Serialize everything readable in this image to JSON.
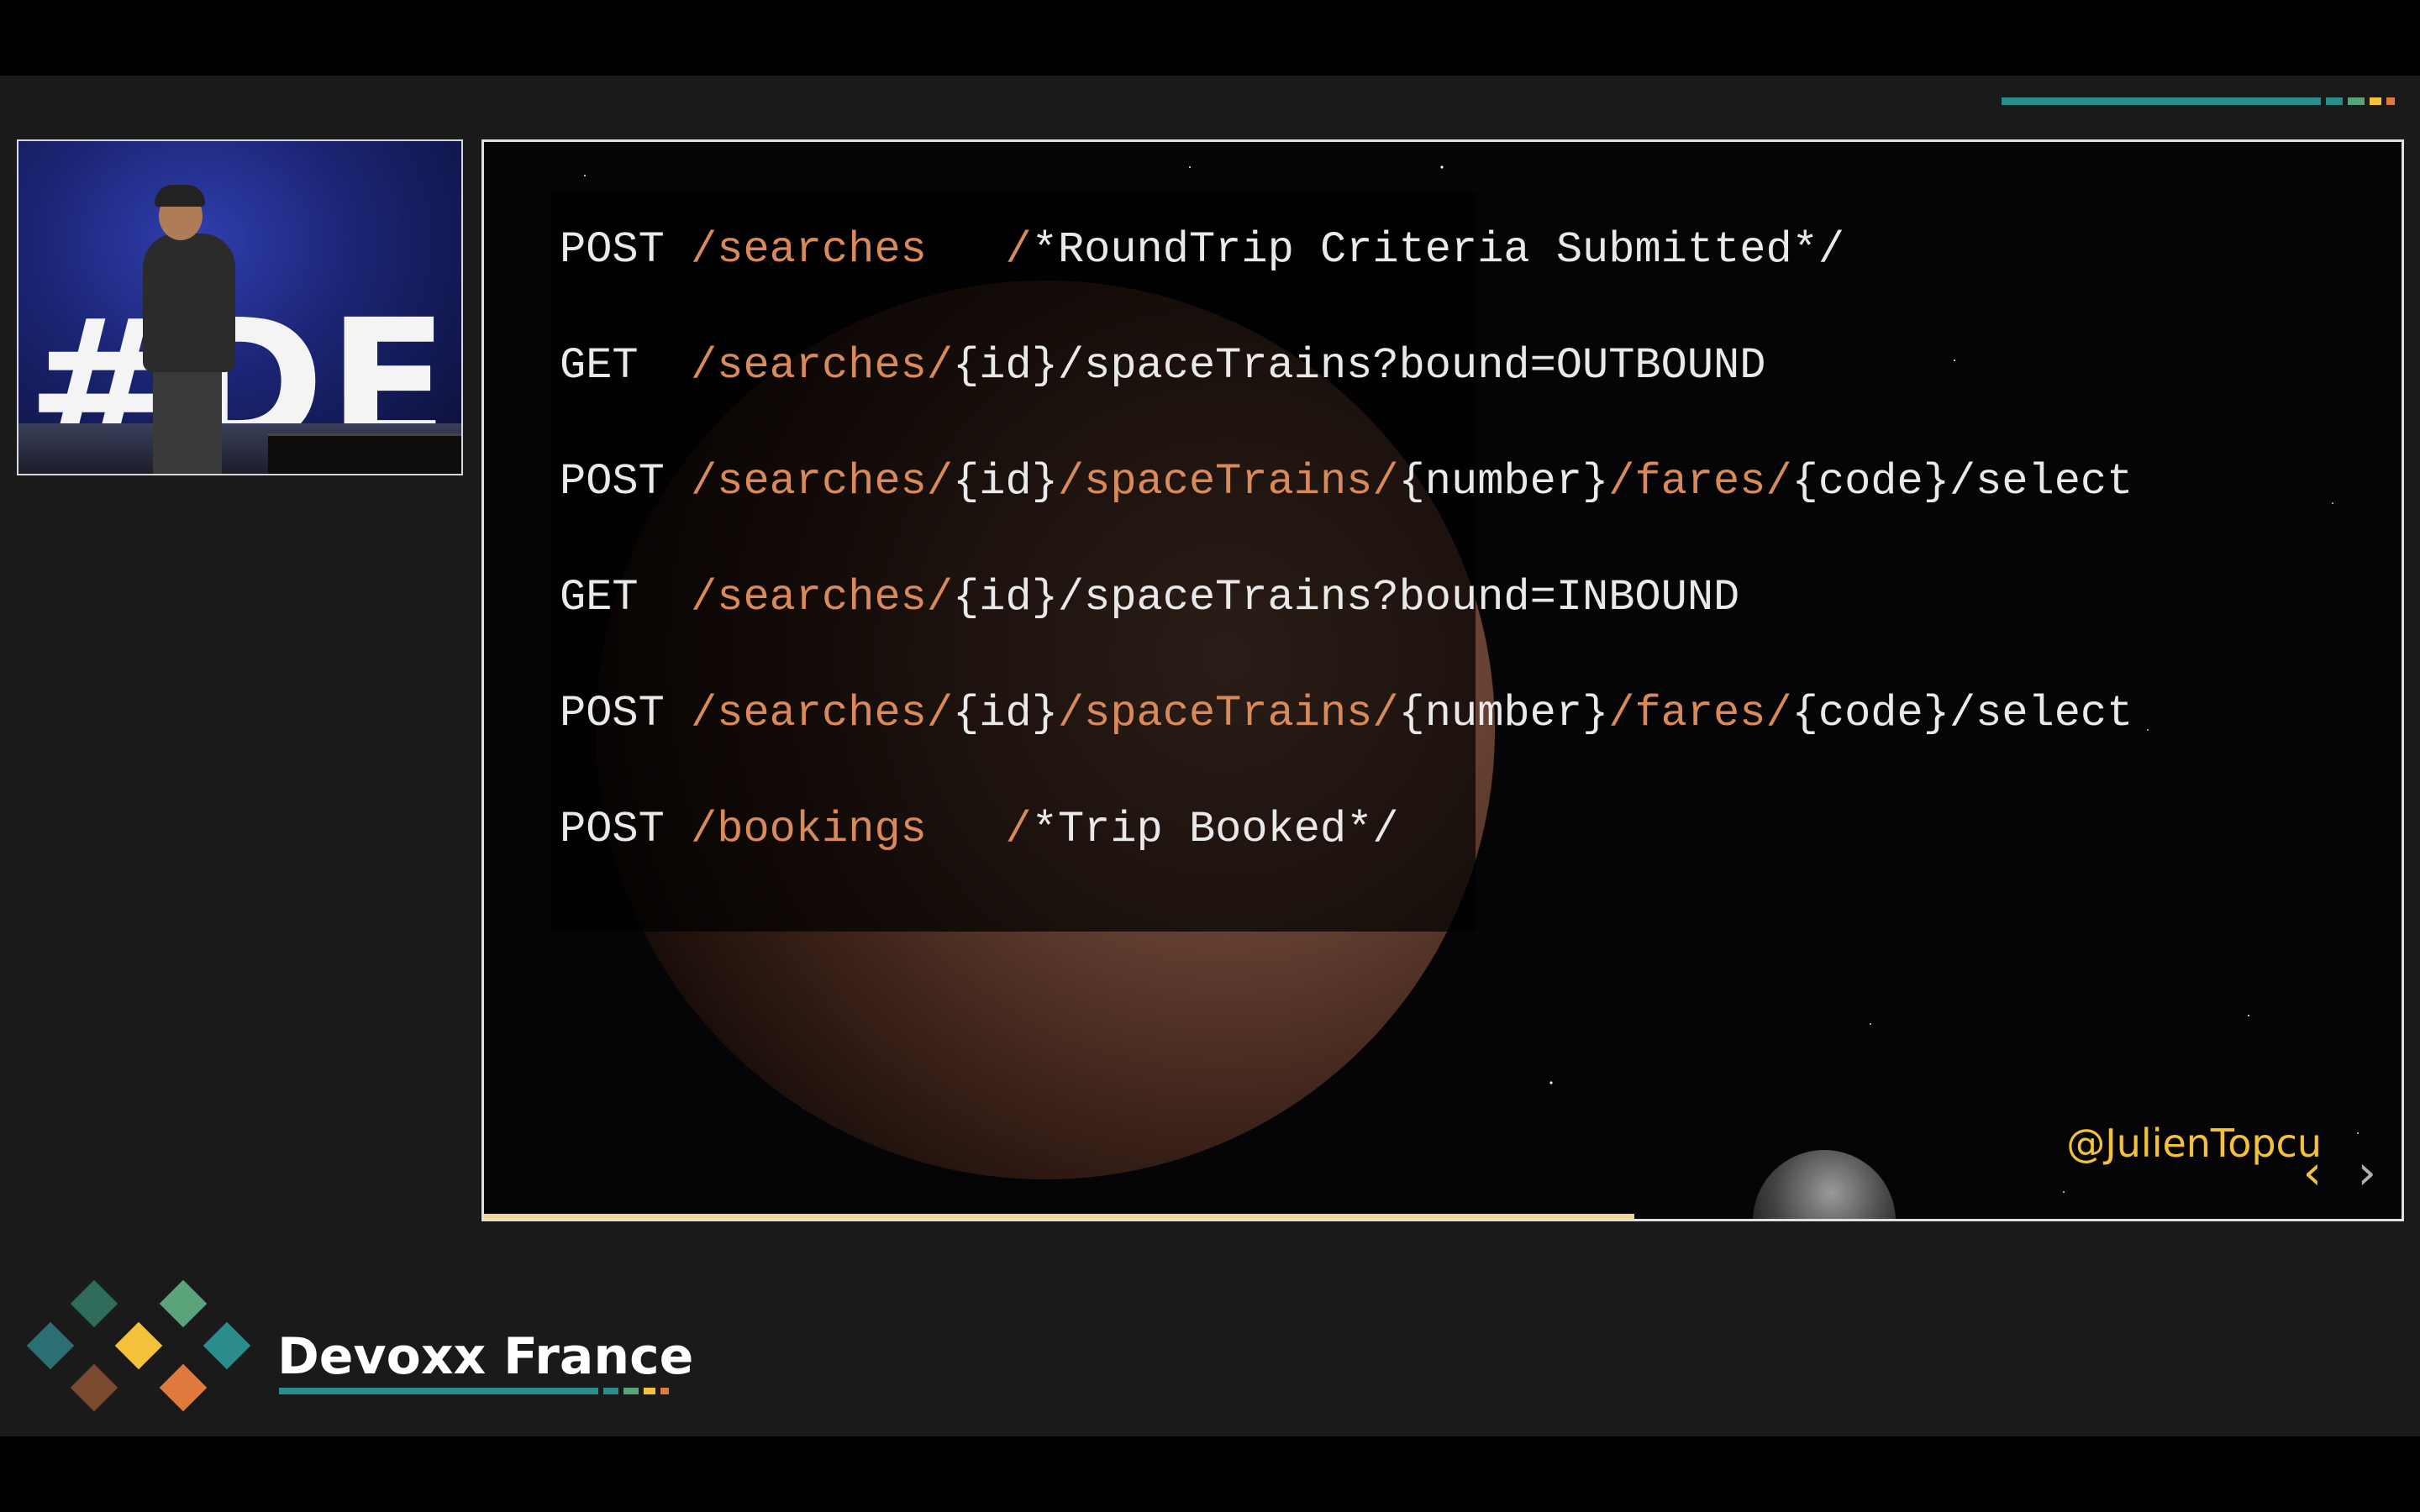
{
  "colors": {
    "background": "#1a1a1a",
    "code_keyword": "#e9e9e9",
    "code_path": "#d98a5a",
    "accent_yellow": "#f4c23a",
    "teal": "#2b8c8c",
    "green": "#5aa37a",
    "orange": "#e07a3c"
  },
  "speaker_video": {
    "stage_sign_text": "#DE"
  },
  "slide": {
    "code_lines": [
      {
        "tokens": [
          {
            "text": "POST ",
            "style": "w"
          },
          {
            "text": "/searches",
            "style": "o"
          },
          {
            "text": "   ",
            "style": "w"
          },
          {
            "text": "/",
            "style": "o"
          },
          {
            "text": "*RoundTrip Criteria Submitted*/",
            "style": "w"
          }
        ]
      },
      {
        "tokens": [
          {
            "text": "GET  ",
            "style": "w"
          },
          {
            "text": "/searches/",
            "style": "o"
          },
          {
            "text": "{id}/spaceTrains?bound=OUTBOUND",
            "style": "w"
          }
        ]
      },
      {
        "tokens": [
          {
            "text": "POST ",
            "style": "w"
          },
          {
            "text": "/searches/",
            "style": "o"
          },
          {
            "text": "{id}",
            "style": "w"
          },
          {
            "text": "/spaceTrains/",
            "style": "o"
          },
          {
            "text": "{number}",
            "style": "w"
          },
          {
            "text": "/fares/",
            "style": "o"
          },
          {
            "text": "{code}/select",
            "style": "w"
          }
        ]
      },
      {
        "tokens": [
          {
            "text": "GET  ",
            "style": "w"
          },
          {
            "text": "/searches/",
            "style": "o"
          },
          {
            "text": "{id}/spaceTrains?bound=INBOUND",
            "style": "w"
          }
        ]
      },
      {
        "tokens": [
          {
            "text": "POST ",
            "style": "w"
          },
          {
            "text": "/searches/",
            "style": "o"
          },
          {
            "text": "{id}",
            "style": "w"
          },
          {
            "text": "/spaceTrains/",
            "style": "o"
          },
          {
            "text": "{number}",
            "style": "w"
          },
          {
            "text": "/fares/",
            "style": "o"
          },
          {
            "text": "{code}/select",
            "style": "w"
          }
        ]
      },
      {
        "tokens": [
          {
            "text": "POST ",
            "style": "w"
          },
          {
            "text": "/bookings",
            "style": "o"
          },
          {
            "text": "   ",
            "style": "w"
          },
          {
            "text": "/",
            "style": "o"
          },
          {
            "text": "*Trip Booked*/",
            "style": "w"
          }
        ]
      }
    ],
    "author_handle": "@JulienTopcu",
    "prev_icon": "chevron-left-icon",
    "next_icon": "chevron-right-icon",
    "prev_glyph": "‹",
    "next_glyph": "›",
    "progress": 0.6
  },
  "brand": {
    "name": "Devoxx France"
  }
}
